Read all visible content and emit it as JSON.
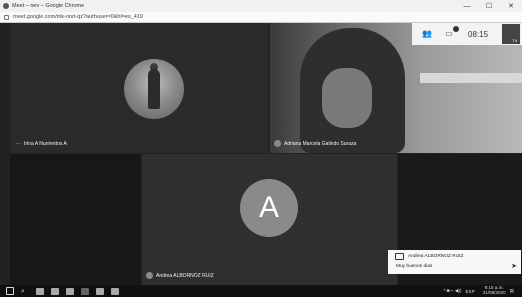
{
  "window": {
    "title": "Meet – nev – Google Chrome",
    "minimize": "—",
    "maximize": "☐",
    "close": "✕"
  },
  "address": {
    "url": "meet.google.com/mk-onrt-qz?authuser=0&hl=es_419"
  },
  "toolbar": {
    "participants_icon": "people-icon",
    "chat_icon": "chat-icon",
    "chat_badge": "",
    "time": "08:15",
    "self_label": "Tú"
  },
  "participants": [
    {
      "name": "Irina A Nurrientos A"
    },
    {
      "name": "Adriana Marcela Galindo Suraza"
    },
    {
      "name": "Andrea ALBORNOZ RUIZ",
      "initial": "A"
    }
  ],
  "toast": {
    "sender": "Andrea ALBORNOZ RUIZ",
    "message": "Muy buenos dias",
    "send_icon": "send-icon"
  },
  "taskbar": {
    "lang": "ESP",
    "time": "9:15 a.m.",
    "date": "31/08/2020",
    "tray": "^ ◙ ⌁ ◀))"
  }
}
